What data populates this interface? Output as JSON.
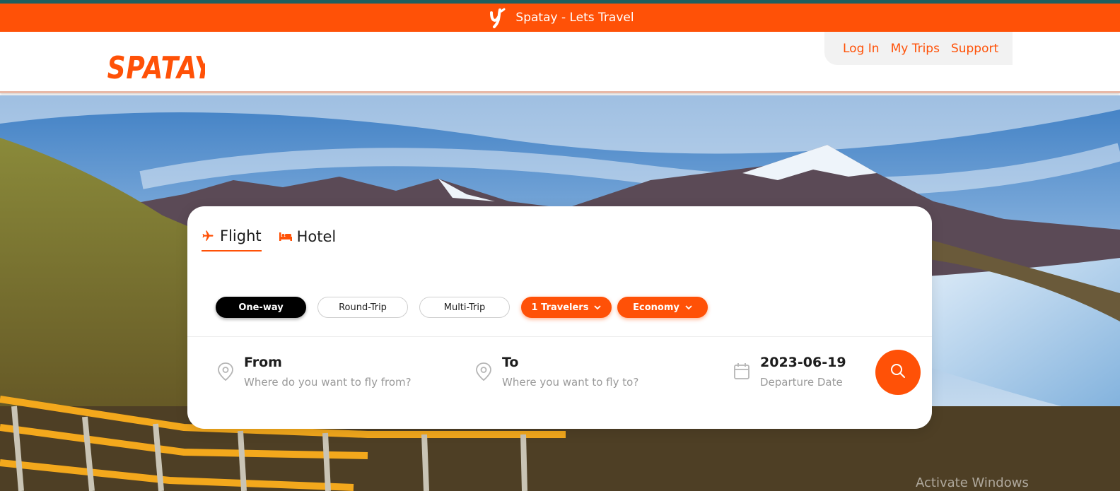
{
  "banner": {
    "text": "Spatay - Lets Travel"
  },
  "header": {
    "logo_text": "SPATAY",
    "nav": [
      {
        "label": "Log In"
      },
      {
        "label": "My Trips"
      },
      {
        "label": "Support"
      }
    ]
  },
  "search": {
    "tabs": [
      {
        "label": "Flight",
        "icon": "plane-icon",
        "active": true
      },
      {
        "label": "Hotel",
        "icon": "bed-icon",
        "active": false
      }
    ],
    "trip_types": [
      {
        "label": "One-way",
        "selected": true
      },
      {
        "label": "Round-Trip",
        "selected": false
      },
      {
        "label": "Multi-Trip",
        "selected": false
      }
    ],
    "travelers_label": "1 Travelers",
    "class_label": "Economy",
    "from": {
      "title": "From",
      "placeholder": "Where do you want to fly from?"
    },
    "to": {
      "title": "To",
      "placeholder": "Where you want to fly to?"
    },
    "date": {
      "title": "2023-06-19",
      "subtitle": "Departure Date"
    }
  },
  "watermark": "Activate Windows",
  "colors": {
    "accent": "#ff5107",
    "dark": "#000000",
    "muted": "#9a9a9a"
  }
}
